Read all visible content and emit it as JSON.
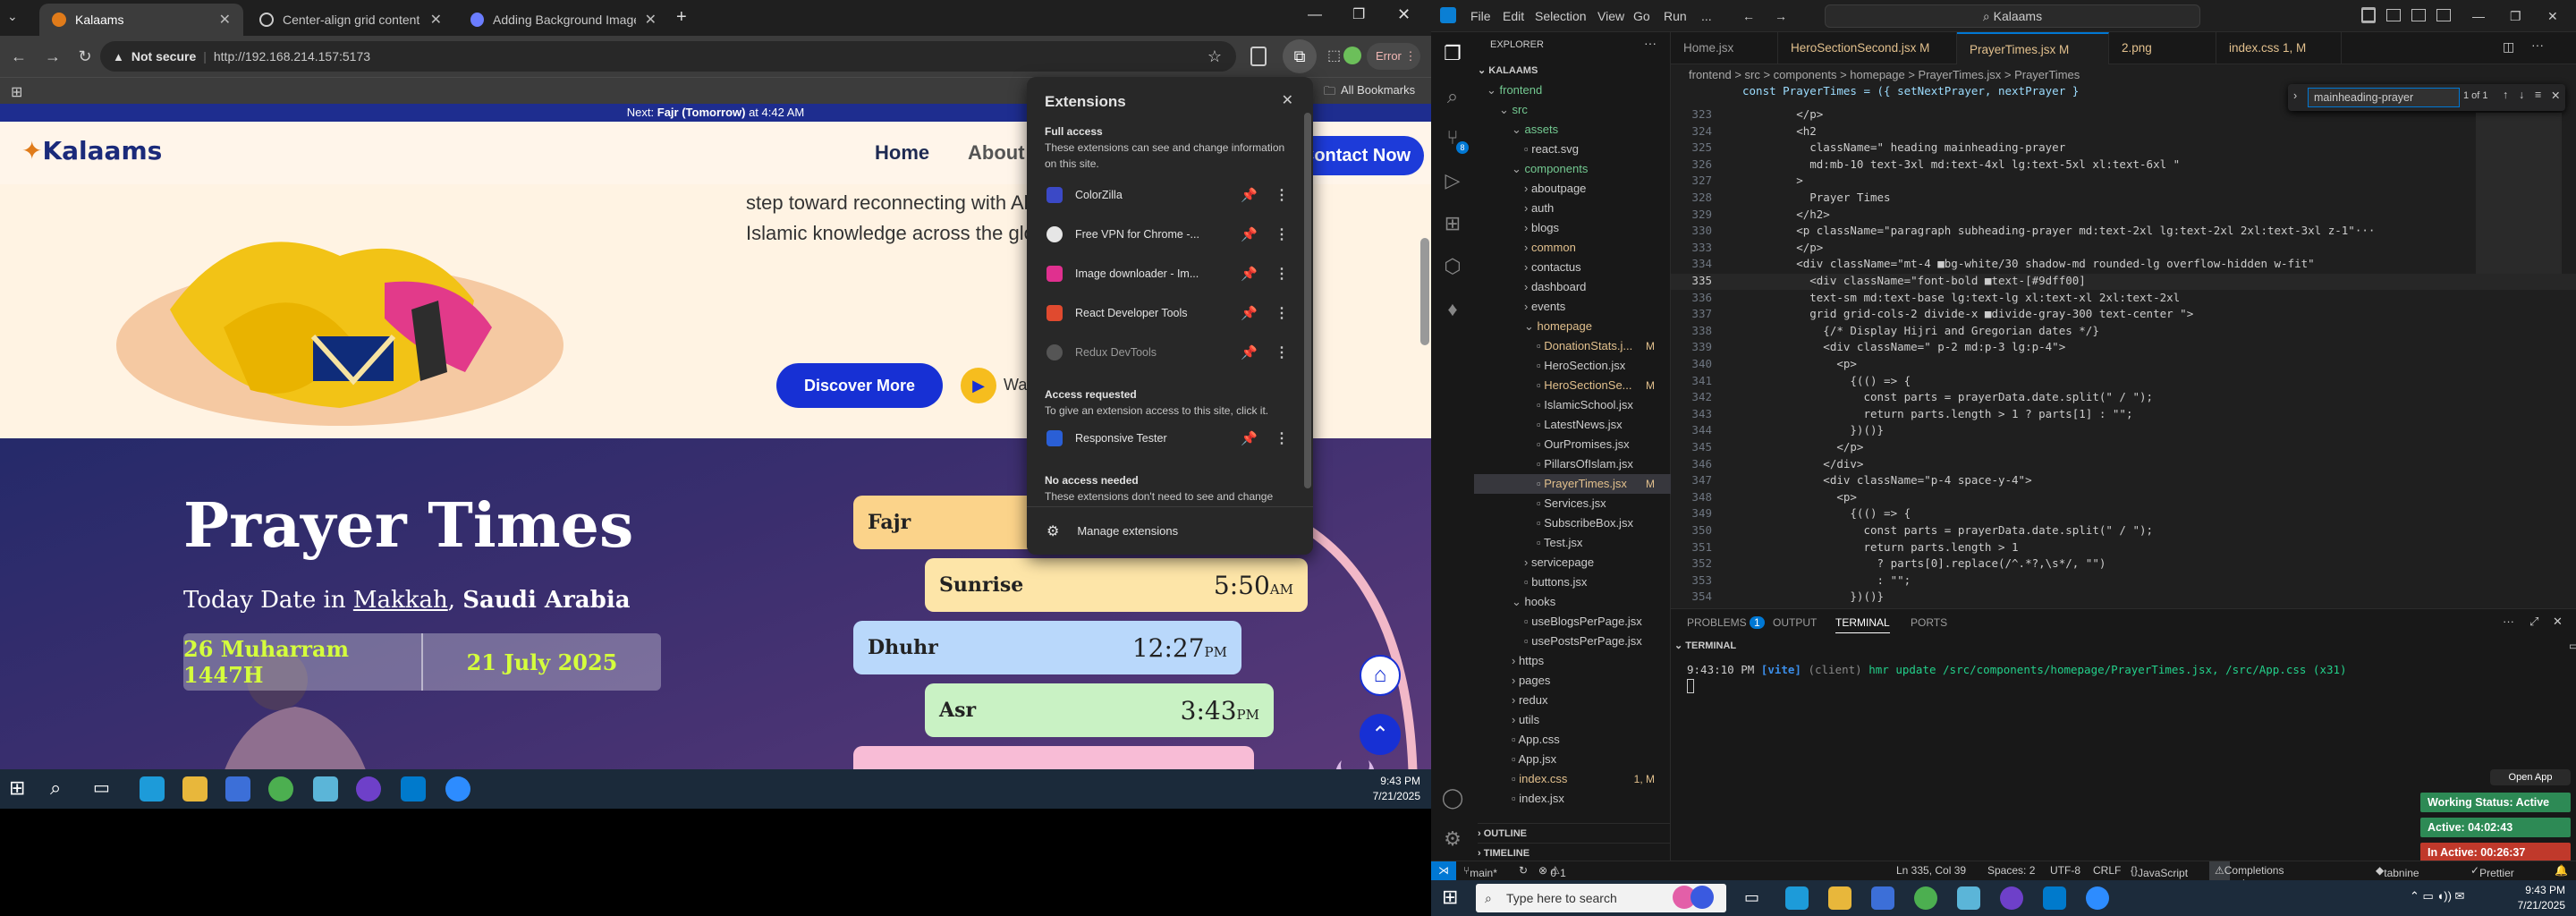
{
  "chrome": {
    "tabs": [
      {
        "title": "Kalaams",
        "active": true
      },
      {
        "title": "Center-align grid content",
        "active": false
      },
      {
        "title": "Adding Background Image to R",
        "active": false
      }
    ],
    "new_tab": "+",
    "not_secure": "Not secure",
    "url": "http://192.168.214.157:5173",
    "error_label": "Error",
    "all_bookmarks": "All Bookmarks"
  },
  "site": {
    "next_prayer_prefix": "Next: ",
    "next_prayer_bold": "Fajr (Tomorrow)",
    "next_prayer_suffix": " at 4:42 AM",
    "logo": "Kalaams",
    "nav": [
      "Home",
      "About"
    ],
    "contact_btn": "Contact Now",
    "hero_text_1": "step toward reconnecting with Allah",
    "hero_text_2": "Islamic knowledge across the globe",
    "discover_btn": "Discover More",
    "watch_label": "Wa",
    "prayer_title": "Prayer Times",
    "today_prefix": "Today Date in ",
    "city": "Makkah",
    "country": "Saudi Arabia",
    "hijri": "26 Muharram 1447H",
    "gregorian": "21 July 2025",
    "prayers": [
      {
        "name": "Fajr",
        "time": "",
        "ampm": ""
      },
      {
        "name": "Sunrise",
        "time": "5:50",
        "ampm": "AM"
      },
      {
        "name": "Dhuhr",
        "time": "12:27",
        "ampm": "PM"
      },
      {
        "name": "Asr",
        "time": "3:43",
        "ampm": "PM"
      }
    ]
  },
  "extensions": {
    "title": "Extensions",
    "full_access": "Full access",
    "full_access_desc": "These extensions can see and change information on this site.",
    "items": [
      {
        "name": "ColorZilla",
        "color": "#3b49c6"
      },
      {
        "name": "Free VPN for Chrome -...",
        "color": "#e6e6e6"
      },
      {
        "name": "Image downloader - Im...",
        "color": "#e0308f"
      },
      {
        "name": "React Developer Tools",
        "color": "#e04a2f"
      },
      {
        "name": "Redux DevTools",
        "color": "#555"
      }
    ],
    "access_requested": "Access requested",
    "access_requested_desc": "To give an extension access to this site, click it.",
    "requested_items": [
      {
        "name": "Responsive Tester",
        "color": "#2a5fd6"
      }
    ],
    "no_access": "No access needed",
    "no_access_desc": "These extensions don't need to see and change",
    "manage": "Manage extensions"
  },
  "taskbar_left": {
    "time": "9:43 PM",
    "date": "7/21/2025"
  },
  "vscode": {
    "menu": [
      "File",
      "Edit",
      "Selection",
      "View",
      "Go",
      "Run",
      "..."
    ],
    "search": "Kalaams",
    "explorer_title": "EXPLORER",
    "root": "KALAAMS",
    "tree": [
      {
        "label": "frontend",
        "depth": 1,
        "open": true,
        "cls": "grn"
      },
      {
        "label": "src",
        "depth": 2,
        "open": true,
        "cls": "grn"
      },
      {
        "label": "assets",
        "depth": 3,
        "open": true,
        "cls": "grn"
      },
      {
        "label": "react.svg",
        "depth": 4,
        "cls": ""
      },
      {
        "label": "components",
        "depth": 3,
        "open": true,
        "cls": "grn"
      },
      {
        "label": "aboutpage",
        "depth": 4,
        "open": false,
        "cls": ""
      },
      {
        "label": "auth",
        "depth": 4,
        "open": false,
        "cls": ""
      },
      {
        "label": "blogs",
        "depth": 4,
        "open": false,
        "cls": ""
      },
      {
        "label": "common",
        "depth": 4,
        "open": false,
        "cls": "mod"
      },
      {
        "label": "contactus",
        "depth": 4,
        "open": false,
        "cls": ""
      },
      {
        "label": "dashboard",
        "depth": 4,
        "open": false,
        "cls": ""
      },
      {
        "label": "events",
        "depth": 4,
        "open": false,
        "cls": ""
      },
      {
        "label": "homepage",
        "depth": 4,
        "open": true,
        "cls": "mod"
      },
      {
        "label": "DonationStats.j...",
        "depth": 5,
        "cls": "mod",
        "badge": "M"
      },
      {
        "label": "HeroSection.jsx",
        "depth": 5,
        "cls": ""
      },
      {
        "label": "HeroSectionSe...",
        "depth": 5,
        "cls": "mod",
        "badge": "M"
      },
      {
        "label": "IslamicSchool.jsx",
        "depth": 5,
        "cls": ""
      },
      {
        "label": "LatestNews.jsx",
        "depth": 5,
        "cls": ""
      },
      {
        "label": "OurPromises.jsx",
        "depth": 5,
        "cls": ""
      },
      {
        "label": "PillarsOfIslam.jsx",
        "depth": 5,
        "cls": ""
      },
      {
        "label": "PrayerTimes.jsx",
        "depth": 5,
        "cls": "mod",
        "badge": "M",
        "sel": true
      },
      {
        "label": "Services.jsx",
        "depth": 5,
        "cls": ""
      },
      {
        "label": "SubscribeBox.jsx",
        "depth": 5,
        "cls": ""
      },
      {
        "label": "Test.jsx",
        "depth": 5,
        "cls": ""
      },
      {
        "label": "servicepage",
        "depth": 4,
        "open": false,
        "cls": ""
      },
      {
        "label": "buttons.jsx",
        "depth": 4,
        "cls": ""
      },
      {
        "label": "hooks",
        "depth": 3,
        "open": true,
        "cls": ""
      },
      {
        "label": "useBlogsPerPage.jsx",
        "depth": 4,
        "cls": ""
      },
      {
        "label": "usePostsPerPage.jsx",
        "depth": 4,
        "cls": ""
      },
      {
        "label": "https",
        "depth": 3,
        "open": false,
        "cls": ""
      },
      {
        "label": "pages",
        "depth": 3,
        "open": false,
        "cls": ""
      },
      {
        "label": "redux",
        "depth": 3,
        "open": false,
        "cls": ""
      },
      {
        "label": "utils",
        "depth": 3,
        "open": false,
        "cls": ""
      },
      {
        "label": "App.css",
        "depth": 3,
        "cls": ""
      },
      {
        "label": "App.jsx",
        "depth": 3,
        "cls": ""
      },
      {
        "label": "index.css",
        "depth": 3,
        "cls": "mod",
        "badge": "1, M"
      },
      {
        "label": "index.jsx",
        "depth": 3,
        "cls": ""
      }
    ],
    "outline": "OUTLINE",
    "timeline": "TIMELINE",
    "editor_tabs": [
      {
        "label": "Home.jsx",
        "active": false
      },
      {
        "label": "HeroSectionSecond.jsx M",
        "active": false
      },
      {
        "label": "PrayerTimes.jsx M",
        "active": true
      },
      {
        "label": "2.png",
        "active": false
      },
      {
        "label": "index.css 1, M",
        "active": false
      }
    ],
    "breadcrumb": "frontend > src > components > homepage > PrayerTimes.jsx > PrayerTimes",
    "sticky": "const PrayerTimes = ({ setNextPrayer, nextPrayer }",
    "find_value": "mainheading-prayer",
    "find_result": "1 of 1",
    "code": [
      {
        "n": "323",
        "t": "        </p>"
      },
      {
        "n": "324",
        "t": "        <h2"
      },
      {
        "n": "325",
        "t": "          className=\" heading mainheading-prayer"
      },
      {
        "n": "326",
        "t": "          md:mb-10 text-3xl md:text-4xl lg:text-5xl xl:text-6xl \""
      },
      {
        "n": "327",
        "t": "        >"
      },
      {
        "n": "328",
        "t": "          Prayer Times"
      },
      {
        "n": "329",
        "t": "        </h2>"
      },
      {
        "n": "330",
        "t": "        <p className=\"paragraph subheading-prayer md:text-2xl lg:text-2xl 2xl:text-3xl z-1\"···"
      },
      {
        "n": "333",
        "t": "        </p>"
      },
      {
        "n": "334",
        "t": "        <div className=\"mt-4 ■bg-white/30 shadow-md rounded-lg overflow-hidden w-fit\""
      },
      {
        "n": "335",
        "t": "          <div className=\"font-bold ■text-[#9dff00]"
      },
      {
        "n": "336",
        "t": "          text-sm md:text-base lg:text-lg xl:text-xl 2xl:text-2xl"
      },
      {
        "n": "337",
        "t": "          grid grid-cols-2 divide-x ■divide-gray-300 text-center \">"
      },
      {
        "n": "338",
        "t": "            {/* Display Hijri and Gregorian dates */}"
      },
      {
        "n": "339",
        "t": "            <div className=\" p-2 md:p-3 lg:p-4\">"
      },
      {
        "n": "340",
        "t": "              <p>"
      },
      {
        "n": "341",
        "t": "                {(() => {"
      },
      {
        "n": "342",
        "t": "                  const parts = prayerData.date.split(\" / \");"
      },
      {
        "n": "343",
        "t": "                  return parts.length > 1 ? parts[1] : \"\";"
      },
      {
        "n": "344",
        "t": "                })()}"
      },
      {
        "n": "345",
        "t": "              </p>"
      },
      {
        "n": "346",
        "t": "            </div>"
      },
      {
        "n": "347",
        "t": "            <div className=\"p-4 space-y-4\">"
      },
      {
        "n": "348",
        "t": "              <p>"
      },
      {
        "n": "349",
        "t": "                {(() => {"
      },
      {
        "n": "350",
        "t": "                  const parts = prayerData.date.split(\" / \");"
      },
      {
        "n": "351",
        "t": "                  return parts.length > 1"
      },
      {
        "n": "352",
        "t": "                    ? parts[0].replace(/^.*?,\\s*/, \"\")"
      },
      {
        "n": "353",
        "t": "                    : \"\";"
      },
      {
        "n": "354",
        "t": "                })()}"
      }
    ],
    "panel_tabs": [
      "PROBLEMS",
      "OUTPUT",
      "TERMINAL",
      "PORTS"
    ],
    "problems_count": "1",
    "terminal_label": "TERMINAL",
    "terminal_time": "9:43:10 PM",
    "terminal_vite": "[vite]",
    "terminal_client": "(client)",
    "terminal_msg": "hmr update /src/components/homepage/PrayerTimes.jsx, /src/App.css (x31)",
    "open_app": "Open App",
    "working_status": "Working Status: Active",
    "active_time": "Active: 04:02:43",
    "inactive_time": "In Active: 00:26:37",
    "status": {
      "branch": "main*",
      "errors": "0",
      "warnings": "1",
      "position": "Ln 335, Col 39",
      "spaces": "Spaces: 2",
      "encoding": "UTF-8",
      "eol": "CRLF",
      "language": "JavaScript JSX",
      "quota": "Completions quota reached",
      "tabnine": "tabnine basic",
      "prettier": "Prettier"
    }
  },
  "taskbar_right": {
    "search_placeholder": "Type here to search",
    "time": "9:43 PM",
    "date": "7/21/2025"
  }
}
